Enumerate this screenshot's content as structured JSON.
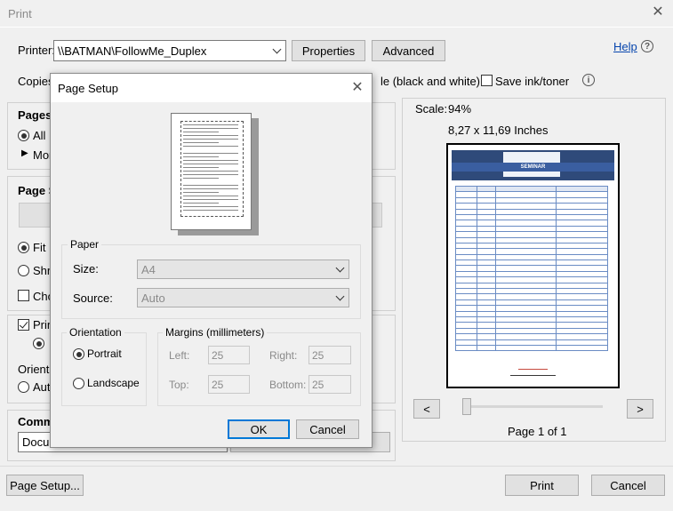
{
  "window": {
    "title": "Print"
  },
  "printer": {
    "label": "Printer:",
    "selected": "\\\\BATMAN\\FollowMe_Duplex",
    "properties_button": "Properties",
    "advanced_button": "Advanced",
    "help_link": "Help"
  },
  "copies": {
    "label": "Copies"
  },
  "options": {
    "grayscale_label": "le (black and white)",
    "grayscale_checked": false,
    "save_ink_label": "Save ink/toner",
    "save_ink_checked": false
  },
  "pages": {
    "heading": "Pages t",
    "all_label": "All",
    "more_label": "Mor"
  },
  "page_sizing": {
    "heading": "Page S",
    "fit_label": "Fit",
    "shrink_label": "Shri",
    "choose_label": "Cho"
  },
  "print_both": {
    "label": "Prin"
  },
  "orientation_main": {
    "heading": "Orientat",
    "auto_label": "Auto"
  },
  "comments": {
    "heading": "Comm",
    "selected": "Docu"
  },
  "preview": {
    "scale_label": "Scale:",
    "scale_value": "94%",
    "page_size": "8,27 x 11,69 Inches",
    "doc_title": "SEMINAR",
    "prev_button": "<",
    "next_button": ">",
    "page_indicator": "Page 1 of 1"
  },
  "footer": {
    "page_setup_button": "Page Setup...",
    "print_button": "Print",
    "cancel_button": "Cancel"
  },
  "page_setup_dialog": {
    "title": "Page Setup",
    "paper": {
      "group_label": "Paper",
      "size_label": "Size:",
      "size_value": "A4",
      "source_label": "Source:",
      "source_value": "Auto"
    },
    "orientation": {
      "group_label": "Orientation",
      "portrait_label": "Portrait",
      "landscape_label": "Landscape",
      "selected": "Portrait"
    },
    "margins": {
      "group_label": "Margins (millimeters)",
      "left_label": "Left:",
      "left_value": "25",
      "right_label": "Right:",
      "right_value": "25",
      "top_label": "Top:",
      "top_value": "25",
      "bottom_label": "Bottom:",
      "bottom_value": "25"
    },
    "ok_button": "OK",
    "cancel_button": "Cancel"
  }
}
